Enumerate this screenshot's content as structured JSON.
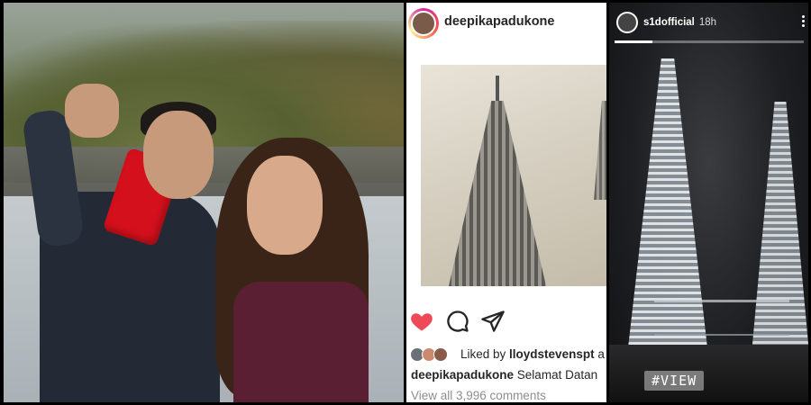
{
  "post": {
    "username": "deepikapadukone",
    "liked_by_prefix": "Liked by ",
    "liked_by_user": "lloydstevenspt",
    "liked_by_suffix": " a",
    "caption_user": "deepikapadukone",
    "caption_text": " Selamat Datan",
    "comments_link": "View all 3,996 comments",
    "like_color": "#ed4956"
  },
  "story": {
    "username": "s1dofficial",
    "time": "18h",
    "badge": "#VIEW",
    "progress": 0.2
  },
  "icons": {
    "like": "heart-icon",
    "comment": "comment-icon",
    "share": "share-icon",
    "menu": "vertical-dots-icon"
  }
}
